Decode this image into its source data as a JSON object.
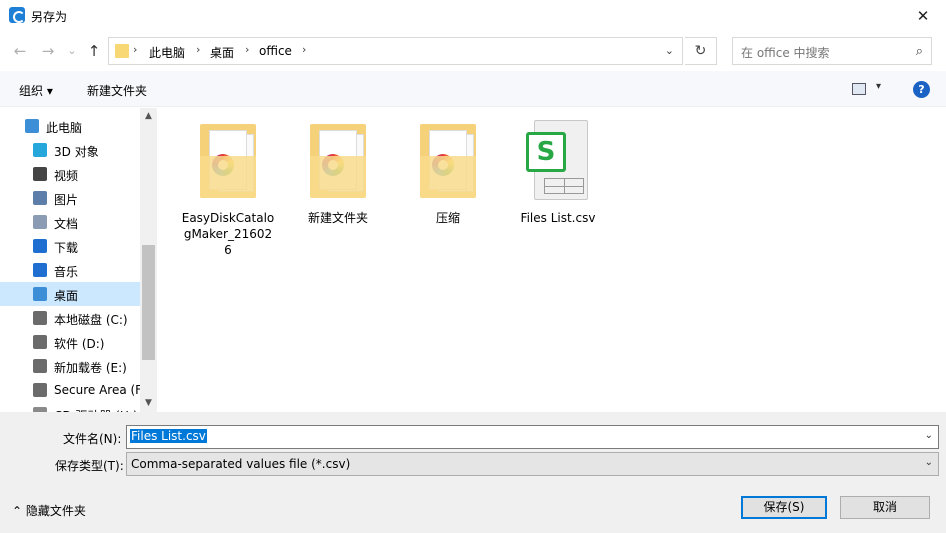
{
  "window": {
    "title": "另存为",
    "close": "✕"
  },
  "nav": {
    "back": "←",
    "forward": "→",
    "recent": "⌄",
    "up": "↑",
    "breadcrumb": [
      "此电脑",
      "桌面",
      "office"
    ],
    "sep": "›",
    "dropdown": "⌄",
    "refresh": "↻",
    "search_placeholder": "在 office 中搜索",
    "search_icon": "⌕"
  },
  "toolbar": {
    "organize": "组织 ▾",
    "new_folder": "新建文件夹",
    "view_caret": "▾",
    "help": "?"
  },
  "sidebar": {
    "items": [
      {
        "label": "此电脑",
        "icon": "computer-icon",
        "color": "#3c8fd6"
      },
      {
        "label": "3D 对象",
        "icon": "cube-icon",
        "color": "#25a7dc"
      },
      {
        "label": "视频",
        "icon": "film-icon",
        "color": "#444444"
      },
      {
        "label": "图片",
        "icon": "image-icon",
        "color": "#5c7ea8"
      },
      {
        "label": "文档",
        "icon": "document-icon",
        "color": "#8a9bb3"
      },
      {
        "label": "下载",
        "icon": "download-icon",
        "color": "#1f6fd1"
      },
      {
        "label": "音乐",
        "icon": "music-icon",
        "color": "#1f6fd1"
      },
      {
        "label": "桌面",
        "icon": "desktop-icon",
        "color": "#3c8fd6",
        "selected": true
      },
      {
        "label": "本地磁盘 (C:)",
        "icon": "drive-icon",
        "color": "#6b6b6b"
      },
      {
        "label": "软件 (D:)",
        "icon": "drive-icon",
        "color": "#6b6b6b"
      },
      {
        "label": "新加载卷 (E:)",
        "icon": "drive-icon",
        "color": "#6b6b6b"
      },
      {
        "label": "Secure Area (F:",
        "icon": "drive-icon",
        "color": "#6b6b6b"
      },
      {
        "label": "CD 驱动器 (H:)",
        "icon": "cd-icon",
        "color": "#8a8a8a"
      }
    ],
    "scroll_up": "▲",
    "scroll_down": "▼"
  },
  "files": [
    {
      "name": "EasyDiskCatalogMaker_216026",
      "type": "folder"
    },
    {
      "name": "新建文件夹",
      "type": "folder"
    },
    {
      "name": "压缩",
      "type": "folder"
    },
    {
      "name": "Files List.csv",
      "type": "csv",
      "badge": "S"
    }
  ],
  "form": {
    "filename_label": "文件名(N):",
    "filename_value": "Files List.csv",
    "type_label": "保存类型(T):",
    "type_value": "Comma-separated values file (*.csv)",
    "caret": "⌄",
    "hide_folders": "⌃ 隐藏文件夹",
    "save": "保存(S)",
    "cancel": "取消"
  },
  "colors": {
    "accent": "#0078d7",
    "selected_row": "#cce8ff",
    "folder": "#f5d27a",
    "csv_green": "#28a745"
  }
}
